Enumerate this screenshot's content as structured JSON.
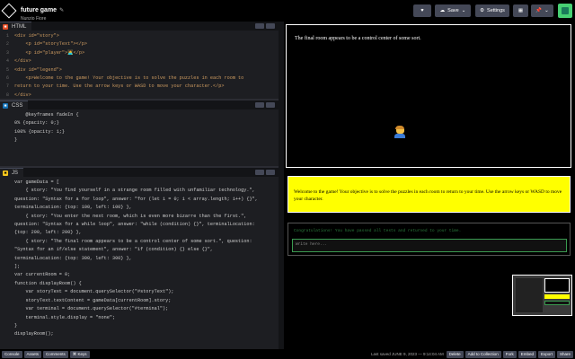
{
  "header": {
    "title": "future game",
    "author": "Nunzio Fiore",
    "buttons": {
      "save": "Save",
      "settings": "Settings"
    }
  },
  "panes": {
    "html": {
      "label": "HTML"
    },
    "css": {
      "label": "CSS"
    },
    "js": {
      "label": "JS"
    }
  },
  "html_code": [
    "<div id=\"story\">",
    "    <p id=\"storyText\"></p>",
    "    <p id=\"player\">🧑‍💻</p>",
    "</div>",
    "<div id=\"legend\">",
    "    <p>Welcome to the game! Your objective is to solve the puzzles in each room to",
    "return to your time. Use the arrow keys or WASD to move your character.</p>",
    "</div>",
    "<div id=\"terminal\">"
  ],
  "css_code": [
    "",
    "    @keyframes fadeIn {",
    "0% {opacity: 0;}",
    "100% {opacity: 1;}",
    "}"
  ],
  "js_code": [
    "var gameData = [",
    "    { story: \"You find yourself in a strange room filled with unfamiliar technology.\",",
    "question: \"Syntax for a for loop\", answer: \"for (let i = 0; i < array.length; i++) {}\",",
    "terminalLocation: {top: 100, left: 100} },",
    "    { story: \"You enter the next room, which is even more bizarre than the first.\",",
    "question: \"Syntax for a while loop\", answer: \"while (condition) {}\", terminalLocation:",
    "{top: 200, left: 200} },",
    "    { story: \"The final room appears to be a control center of some sort.\", question:",
    "\"Syntax for an if/else statement\", answer: \"if (condition) {} else {}\",",
    "terminalLocation: {top: 300, left: 300} },",
    "];",
    "",
    "var currentRoom = 0;",
    "",
    "function displayRoom() {",
    "    var storyText = document.querySelector(\"#storyText\");",
    "    storyText.textContent = gameData[currentRoom].story;",
    "",
    "    var terminal = document.querySelector(\"#terminal\");",
    "    terminal.style.display = \"none\";",
    "}",
    "",
    "displayRoom();"
  ],
  "preview": {
    "story": "The final room appears to be a control center of some sort.",
    "legend": "Welcome to the game! Your objective is to solve the puzzles in each room to return to your time. Use the arrow keys or WASD to move your character.",
    "terminal_output": "Congratulations! You have passed all tests and returned to your time.",
    "terminal_placeholder": "Write here..."
  },
  "footer": {
    "left": [
      "Console",
      "Assets",
      "Comments",
      "⌘ Keys"
    ],
    "saved": "Last saved JUNE 9, 2023 — 9:14:04 AM",
    "right": [
      "Delete",
      "Add to Collection",
      "Fork",
      "Embed",
      "Export",
      "Share"
    ]
  }
}
